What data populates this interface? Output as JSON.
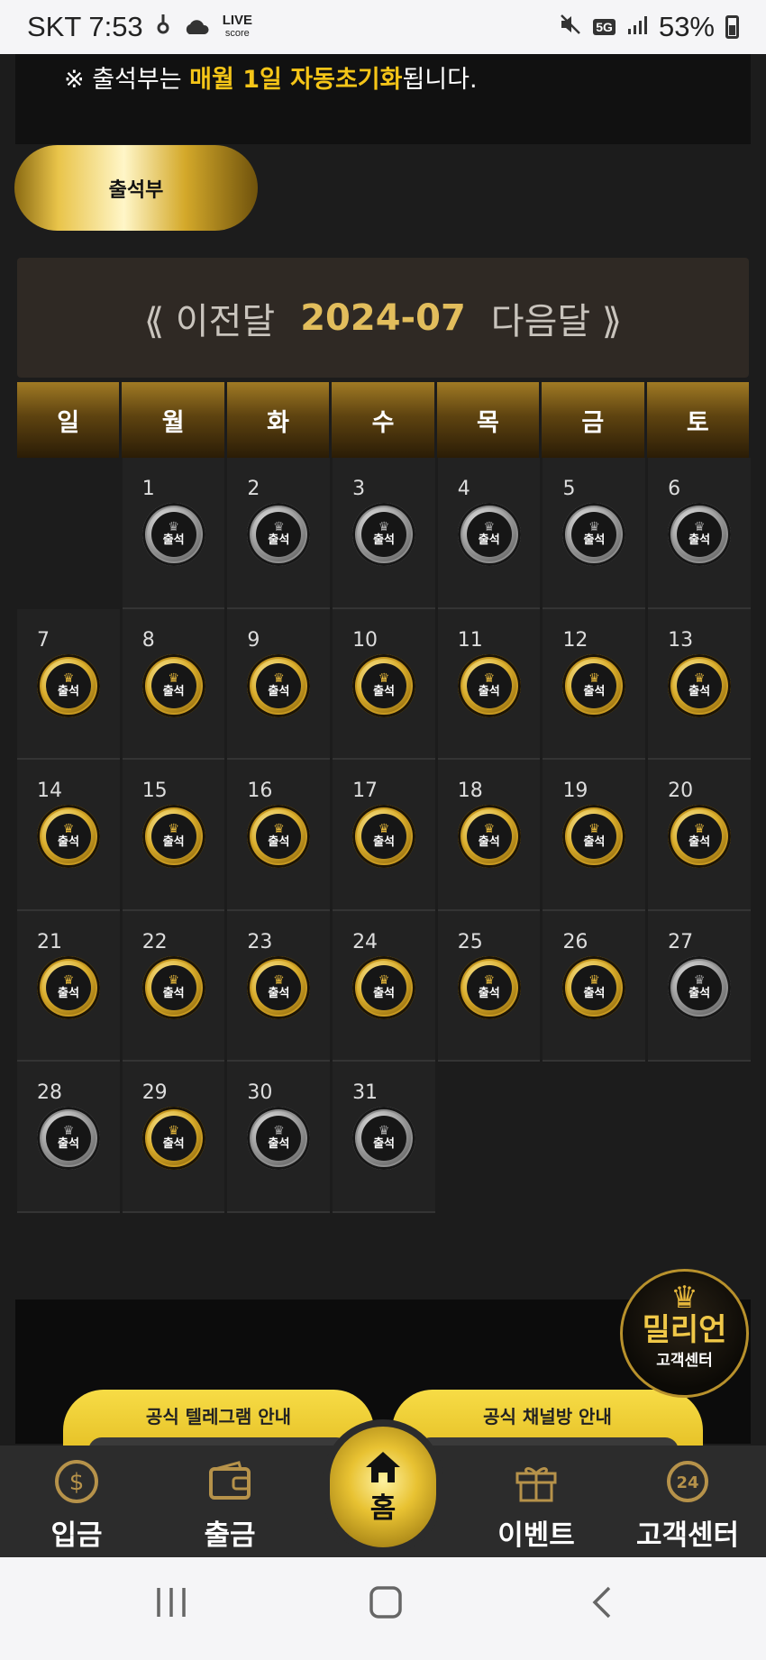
{
  "status_bar": {
    "carrier_time": "SKT 7:53",
    "live_label": "LIVE",
    "live_sub": "score",
    "network": "5G",
    "battery": "53%"
  },
  "notice": {
    "prefix": "※ 출석부는 ",
    "highlight": "매월 1일 자동초기화",
    "suffix": "됩니다."
  },
  "tab_label": "출석부",
  "month_nav": {
    "prev_icon": "⟪",
    "prev_label": "이전달",
    "current": "2024-07",
    "next_label": "다음달",
    "next_icon": "⟫"
  },
  "weekdays": [
    "일",
    "월",
    "화",
    "수",
    "목",
    "금",
    "토"
  ],
  "medal_text": "출석",
  "calendar": {
    "leading_blank": 1,
    "days": [
      {
        "day": "1",
        "status": "silver"
      },
      {
        "day": "2",
        "status": "silver"
      },
      {
        "day": "3",
        "status": "silver"
      },
      {
        "day": "4",
        "status": "silver"
      },
      {
        "day": "5",
        "status": "silver"
      },
      {
        "day": "6",
        "status": "silver"
      },
      {
        "day": "7",
        "status": "gold"
      },
      {
        "day": "8",
        "status": "gold"
      },
      {
        "day": "9",
        "status": "gold"
      },
      {
        "day": "10",
        "status": "gold"
      },
      {
        "day": "11",
        "status": "gold"
      },
      {
        "day": "12",
        "status": "gold"
      },
      {
        "day": "13",
        "status": "gold"
      },
      {
        "day": "14",
        "status": "gold"
      },
      {
        "day": "15",
        "status": "gold"
      },
      {
        "day": "16",
        "status": "gold"
      },
      {
        "day": "17",
        "status": "gold"
      },
      {
        "day": "18",
        "status": "gold"
      },
      {
        "day": "19",
        "status": "gold"
      },
      {
        "day": "20",
        "status": "gold"
      },
      {
        "day": "21",
        "status": "gold"
      },
      {
        "day": "22",
        "status": "gold"
      },
      {
        "day": "23",
        "status": "gold"
      },
      {
        "day": "24",
        "status": "gold"
      },
      {
        "day": "25",
        "status": "gold"
      },
      {
        "day": "26",
        "status": "gold"
      },
      {
        "day": "27",
        "status": "silver"
      },
      {
        "day": "28",
        "status": "silver"
      },
      {
        "day": "29",
        "status": "gold"
      },
      {
        "day": "30",
        "status": "silver"
      },
      {
        "day": "31",
        "status": "silver"
      }
    ]
  },
  "banner": {
    "telegram_label": "공식 텔레그램 안내",
    "channel_label": "공식 채널방 안내"
  },
  "cs_badge": {
    "title": "밀리언",
    "subtitle": "고객센터"
  },
  "bottom_nav": {
    "deposit": "입금",
    "withdraw": "출금",
    "home": "홈",
    "event": "이벤트",
    "support": "고객센터"
  },
  "colors": {
    "gold": "#e2bd5c",
    "highlight": "#f5c518",
    "background": "#1c1c1c"
  }
}
